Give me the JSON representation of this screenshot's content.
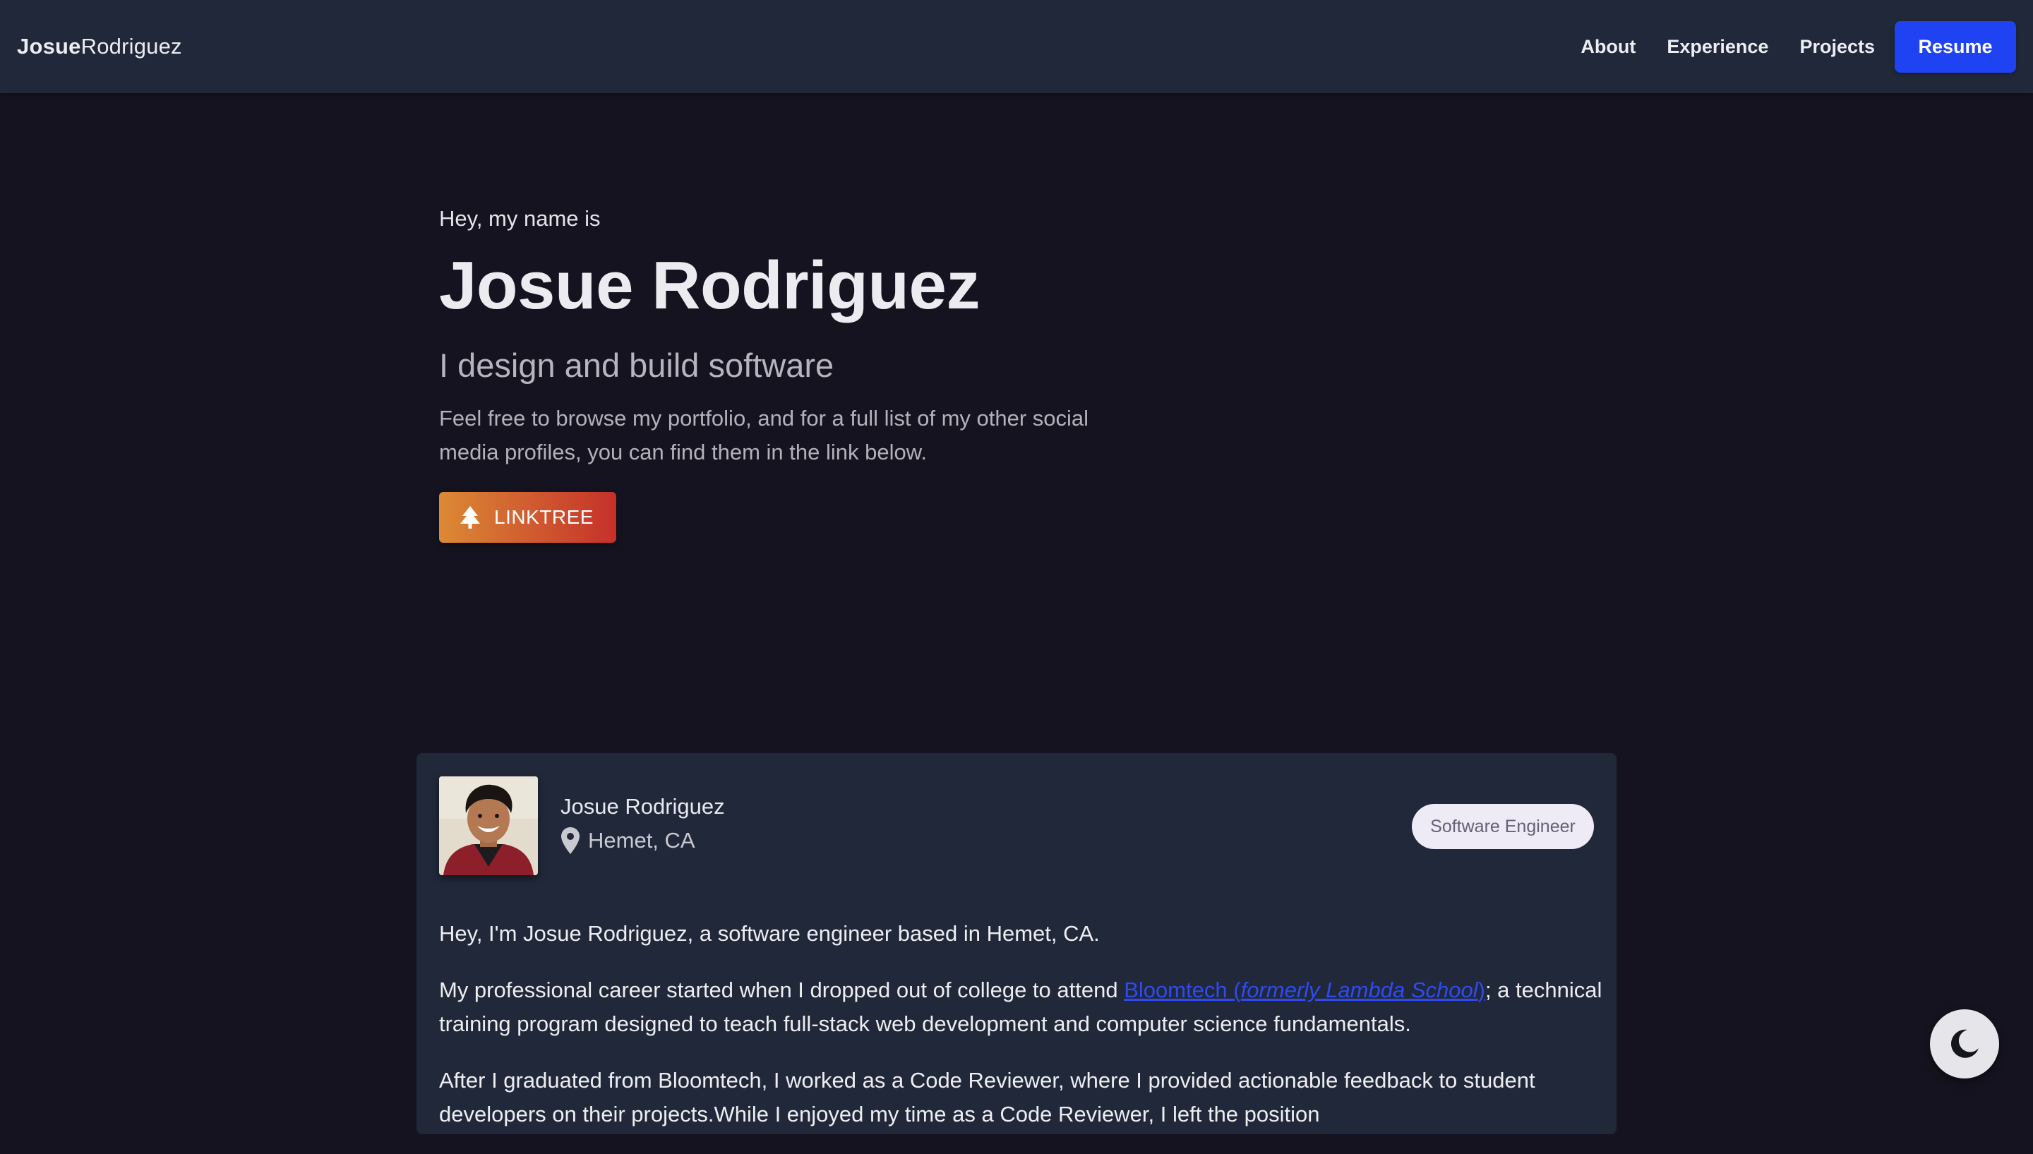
{
  "nav": {
    "brand_bold": "Josue",
    "brand_light": "Rodriguez",
    "links": [
      "About",
      "Experience",
      "Projects"
    ],
    "resume_label": "Resume"
  },
  "hero": {
    "intro": "Hey, my name is",
    "name": "Josue Rodriguez",
    "tagline": "I design and build software",
    "description": "Feel free to browse my portfolio, and for a full list of my other social media profiles, you can find them in the link below.",
    "linktree_label": "LINKTREE",
    "linktree_icon": "tree-icon"
  },
  "profile": {
    "name": "Josue Rodriguez",
    "location": "Hemet, CA",
    "location_icon": "map-pin-icon",
    "badge": "Software Engineer"
  },
  "bio": {
    "p1": "Hey, I'm Josue Rodriguez, a software engineer based in Hemet, CA.",
    "p2_before": "My professional career started when I dropped out of college to attend ",
    "p2_link_text": "Bloomtech (",
    "p2_link_italic": "formerly Lambda School",
    "p2_link_close": ")",
    "p2_after": "; a technical training program designed to teach full-stack web development and computer science fundamentals.",
    "p3": "After I graduated from Bloomtech, I worked as a Code Reviewer, where I provided actionable feedback to student developers on their projects.While I enjoyed my time as a Code Reviewer, I left the position"
  },
  "theme_toggle": {
    "icon": "moon-icon"
  },
  "colors": {
    "page_bg": "#14131f",
    "nav_bg": "#212839",
    "accent": "#1f43f2",
    "link": "#2f4bf0",
    "linktree_start": "#dc8a35",
    "linktree_end": "#c5302a"
  }
}
